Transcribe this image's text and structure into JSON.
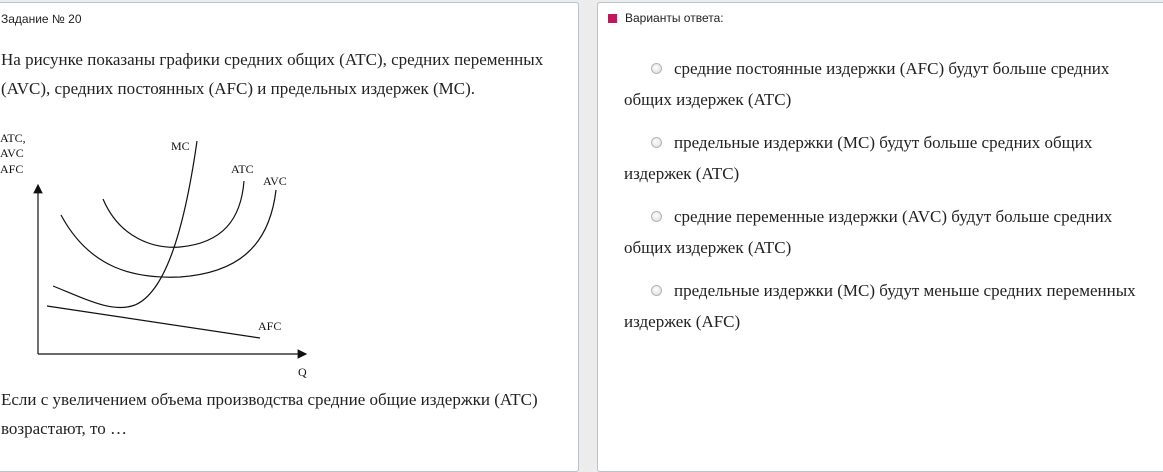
{
  "task": {
    "title": "Задание № 20",
    "question": "На рисунке показаны графики средних общих (ATC), средних переменных (AVC), средних постоянных (AFC) и предельных издержек (MC).",
    "question_tail": "Если с увеличением объема производства средние общие издержки (ATC) возрастают, то …"
  },
  "graph": {
    "y_axis_label": [
      "ATC,",
      "AVC",
      "AFC"
    ],
    "x_axis_label": "Q",
    "curve_labels": {
      "mc": "MC",
      "atc": "ATC",
      "avc": "AVC",
      "afc": "AFC"
    }
  },
  "answers": {
    "title": "Варианты ответа:",
    "marker_color": "#c2185b",
    "options": [
      {
        "label": "средние постоянные издержки (AFC) будут больше средних общих издержек (ATC)",
        "checked": false
      },
      {
        "label": "предельные издержки (MC) будут больше средних общих издержек (ATC)",
        "checked": false
      },
      {
        "label": "средние переменные издержки (AVC) будут больше средних общих издержек (ATC)",
        "checked": false
      },
      {
        "label": "предельные издержки (MC) будут меньше средних переменных издержек (AFC)",
        "checked": false
      }
    ]
  }
}
